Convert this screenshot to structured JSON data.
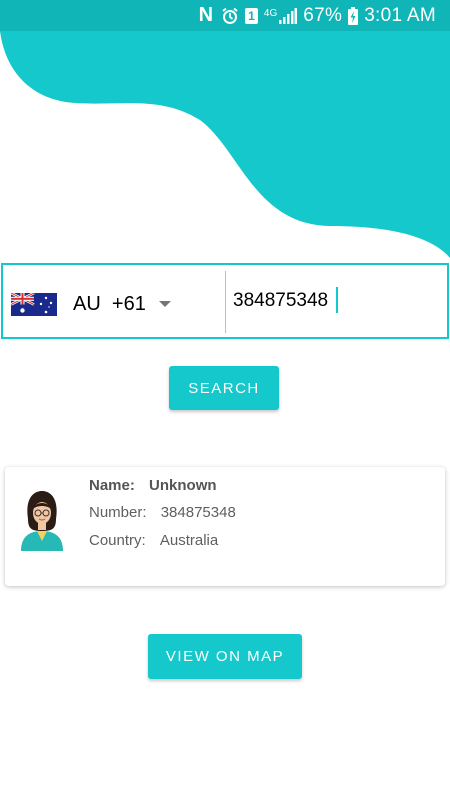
{
  "status_bar": {
    "n_icon": "N",
    "sim_label": "1",
    "network": "4G",
    "battery": "67%",
    "time": "3:01 AM"
  },
  "colors": {
    "accent": "#14c8cb",
    "status_bar": "#0fb5b7"
  },
  "search": {
    "country_code": "AU",
    "dial_code": "+61",
    "phone_value": "384875348",
    "button_label": "SEARCH"
  },
  "result": {
    "name_label": "Name:",
    "name_value": "Unknown",
    "number_label": "Number:",
    "number_value": "384875348",
    "country_label": "Country:",
    "country_value": "Australia"
  },
  "map_button_label": "VIEW ON MAP",
  "icons": [
    "nfc-icon",
    "alarm-icon",
    "sim-icon",
    "signal-icon",
    "battery-charging-icon",
    "australia-flag-icon",
    "dropdown-arrow-icon",
    "avatar-woman-icon"
  ]
}
